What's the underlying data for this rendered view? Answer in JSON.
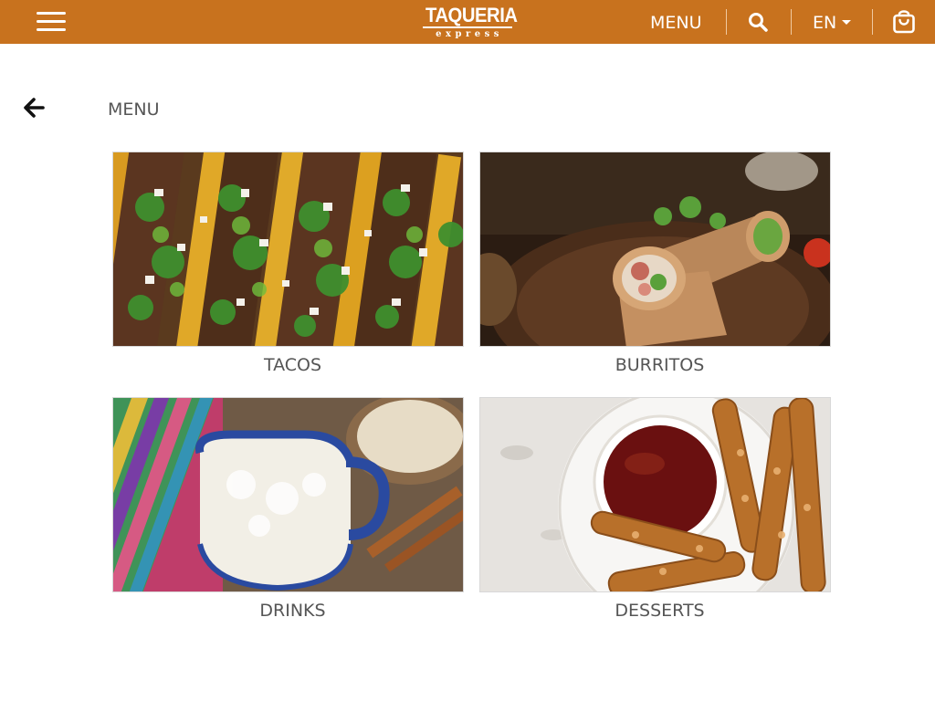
{
  "header": {
    "logo_main": "TAQUERIA",
    "logo_sub": "express",
    "menu_label": "MENU",
    "language": "EN",
    "accent_color": "#c8721e",
    "icons": [
      "hamburger-icon",
      "search-icon",
      "caret-down-icon",
      "shopping-bag-icon"
    ]
  },
  "page": {
    "breadcrumb": "MENU",
    "back_icon": "arrow-left-icon"
  },
  "categories": [
    {
      "label": "TACOS"
    },
    {
      "label": "BURRITOS"
    },
    {
      "label": "DRINKS"
    },
    {
      "label": "DESSERTS"
    }
  ]
}
